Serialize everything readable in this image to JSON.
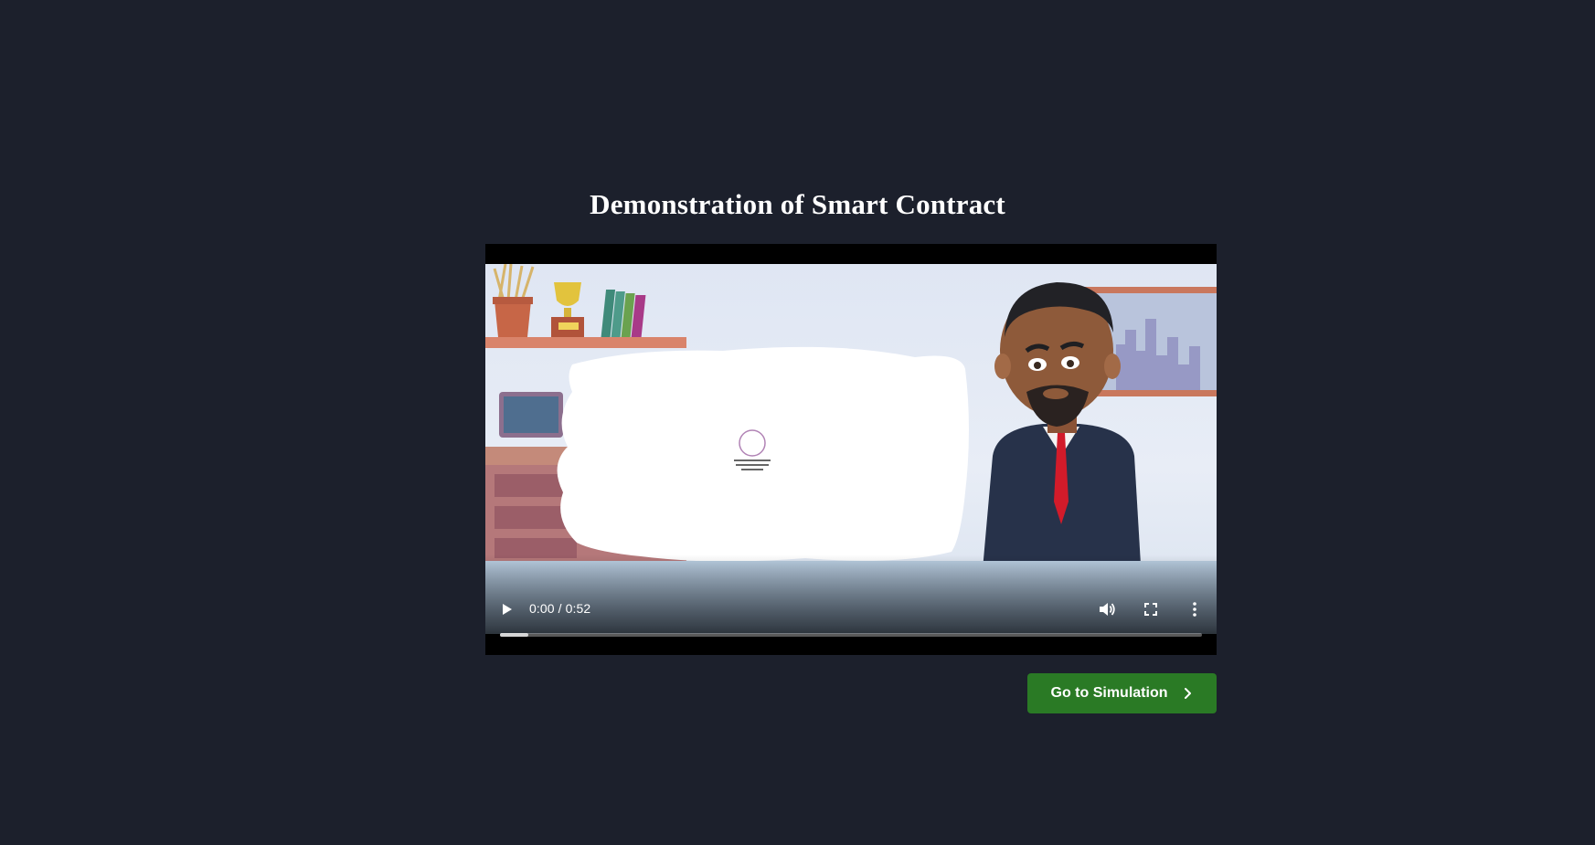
{
  "page": {
    "title": "Demonstration of Smart Contract"
  },
  "video": {
    "current_time": "0:00",
    "duration": "0:52",
    "time_separator": " / ",
    "time_display": "0:00 / 0:52",
    "buffered_fraction": 0.04,
    "played_fraction": 0.0,
    "icons": {
      "play": "play-icon",
      "volume": "volume-icon",
      "fullscreen": "fullscreen-icon",
      "more": "more-options-icon"
    }
  },
  "actions": {
    "next_label": "Go to Simulation",
    "next_icon": "chevron-right-icon"
  },
  "colors": {
    "background": "#1c202c",
    "accent_button": "#2a7a25",
    "title_text": "#ffffff"
  }
}
